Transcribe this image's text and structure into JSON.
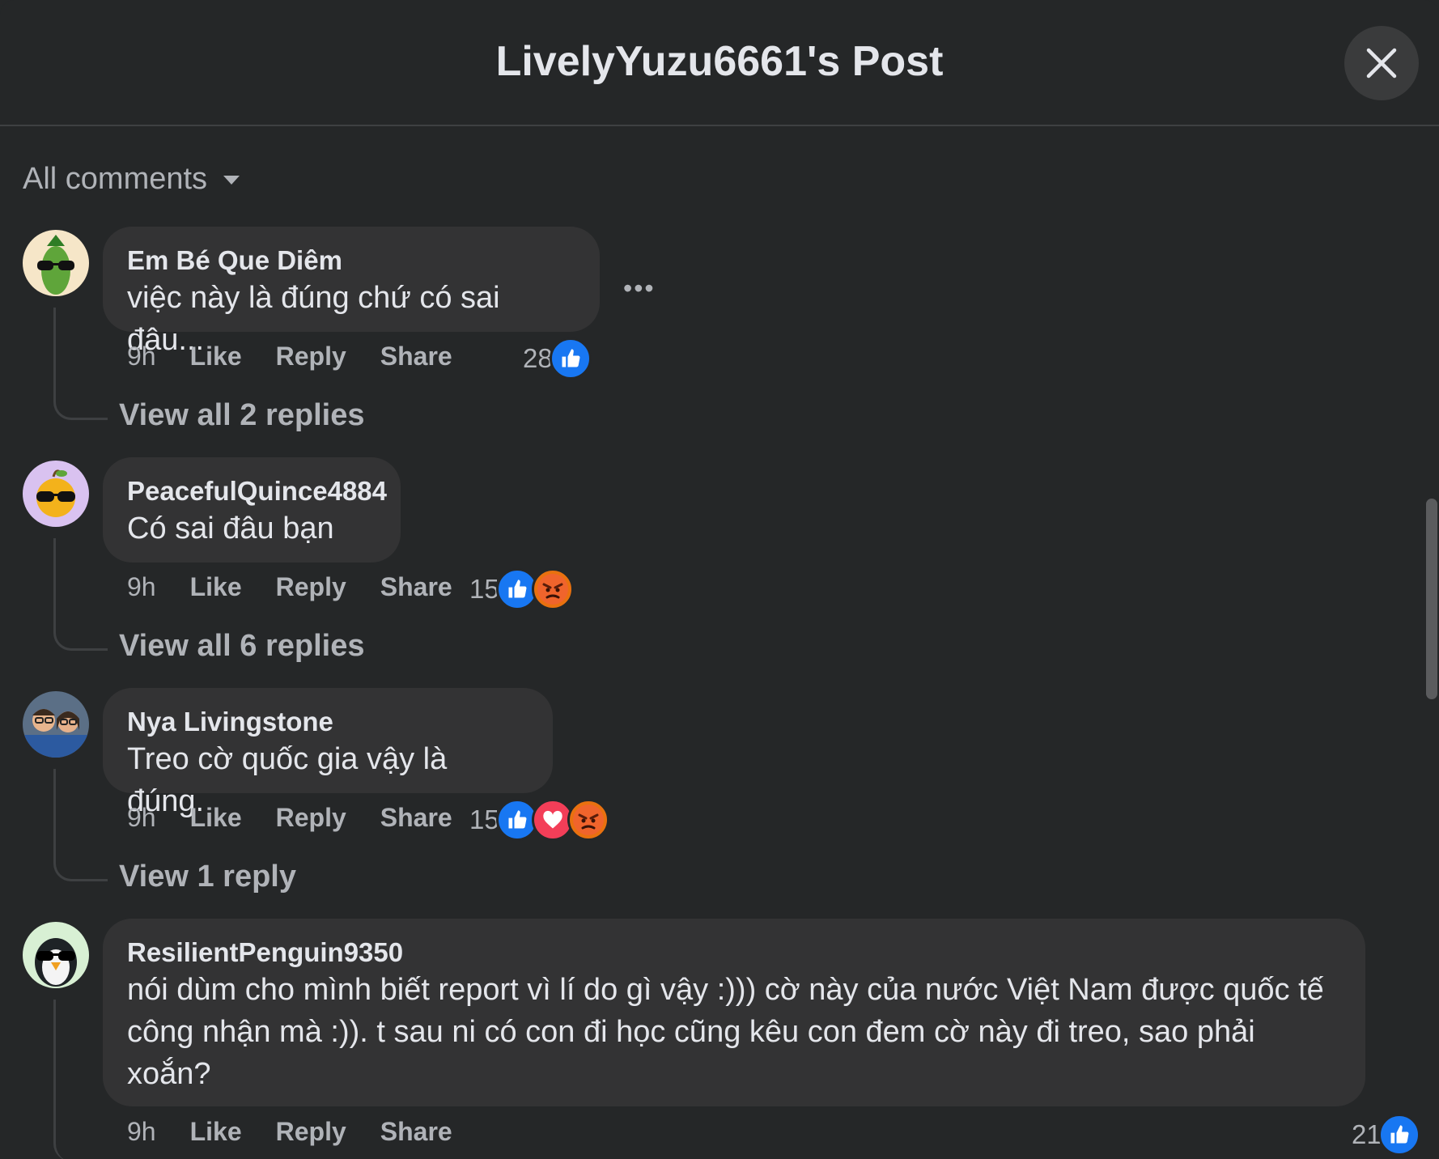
{
  "header": {
    "title": "LivelyYuzu6661's Post"
  },
  "filter": {
    "label": "All comments"
  },
  "comments": [
    {
      "author": "Em Bé Que Diêm",
      "text": "việc này là đúng chứ có sai đâu...",
      "time": "9h",
      "like": "Like",
      "reply": "Reply",
      "share": "Share",
      "reaction_count": "28",
      "reactions": [
        "like"
      ],
      "view_replies": "View all 2 replies"
    },
    {
      "author": "PeacefulQuince4884",
      "text": "Có sai đâu bạn",
      "time": "9h",
      "like": "Like",
      "reply": "Reply",
      "share": "Share",
      "reaction_count": "15",
      "reactions": [
        "like",
        "angry"
      ],
      "view_replies": "View all 6 replies"
    },
    {
      "author": "Nya Livingstone",
      "text": "Treo cờ quốc gia vậy là đúng.",
      "time": "9h",
      "like": "Like",
      "reply": "Reply",
      "share": "Share",
      "reaction_count": "15",
      "reactions": [
        "like",
        "love",
        "angry"
      ],
      "view_replies": "View 1 reply"
    },
    {
      "author": "ResilientPenguin9350",
      "text_lines": [
        "nói dùm cho mình biết report vì lí do gì vậy :))) cờ này của nước Việt Nam được quốc tế",
        "công nhận mà :)). t sau ni có con đi học cũng kêu con đem cờ này đi treo, sao phải",
        "xoắn?"
      ],
      "time": "9h",
      "like": "Like",
      "reply": "Reply",
      "share": "Share",
      "reaction_count": "21",
      "reactions": [
        "like"
      ]
    }
  ],
  "colors": {
    "background": "#252728",
    "bubble": "#333334",
    "like": "#1877f2",
    "love": "#f33e58",
    "angry": "#e9710f"
  },
  "icons": [
    "close-icon",
    "caret-down-icon",
    "more-dots-icon",
    "like-reaction-icon",
    "love-reaction-icon",
    "angry-reaction-icon"
  ]
}
